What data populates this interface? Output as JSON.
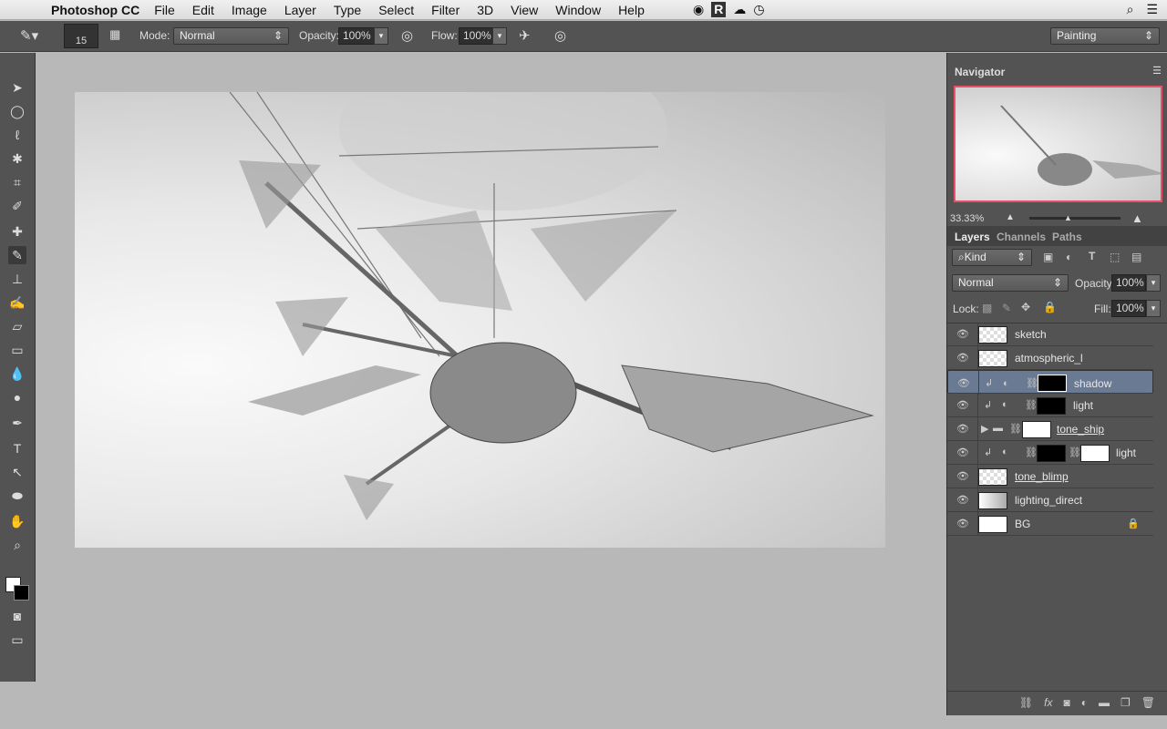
{
  "menubar": {
    "app": "Photoshop CC",
    "items": [
      "File",
      "Edit",
      "Image",
      "Layer",
      "Type",
      "Select",
      "Filter",
      "3D",
      "View",
      "Window",
      "Help"
    ]
  },
  "options": {
    "brush_size": "15",
    "mode_label": "Mode:",
    "mode_value": "Normal",
    "opacity_label": "Opacity:",
    "opacity_value": "100%",
    "flow_label": "Flow:",
    "flow_value": "100%",
    "workspace": "Painting"
  },
  "navigator": {
    "title": "Navigator",
    "zoom": "33.33%"
  },
  "layers_panel": {
    "tabs": [
      "Layers",
      "Channels",
      "Paths"
    ],
    "filter": "Kind",
    "blend_mode": "Normal",
    "opacity_label": "Opacity:",
    "opacity_value": "100%",
    "lock_label": "Lock:",
    "fill_label": "Fill:",
    "fill_value": "100%",
    "layers": [
      {
        "name": "sketch"
      },
      {
        "name": "atmospheric_l"
      },
      {
        "name": "shadow"
      },
      {
        "name": "light"
      },
      {
        "name": "tone_ship"
      },
      {
        "name": "light"
      },
      {
        "name": "tone_blimp"
      },
      {
        "name": "lighting_direct"
      },
      {
        "name": "BG"
      }
    ]
  }
}
